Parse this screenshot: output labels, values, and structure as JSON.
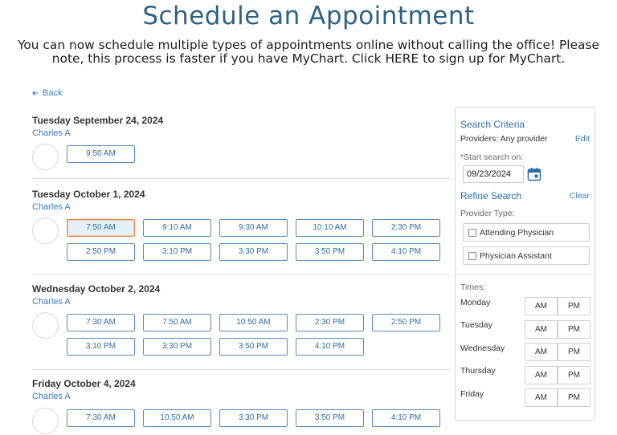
{
  "header": {
    "title": "Schedule an Appointment",
    "intro": "You can now schedule multiple types of appointments online without calling the office! Please note, this process is faster if you have MyChart. Click HERE to sign up for MyChart."
  },
  "back": {
    "label": "Back",
    "icon": "arrow-left-icon"
  },
  "dates": [
    {
      "heading": "Tuesday September 24, 2024",
      "provider": "Charles A",
      "times": [
        "9:50 AM"
      ]
    },
    {
      "heading": "Tuesday October 1, 2024",
      "provider": "Charles A",
      "times": [
        "7:50 AM",
        "9:10 AM",
        "9:30 AM",
        "10:10 AM",
        "2:30 PM",
        "2:50 PM",
        "3:10 PM",
        "3:30 PM",
        "3:50 PM",
        "4:10 PM"
      ]
    },
    {
      "heading": "Wednesday October 2, 2024",
      "provider": "Charles A",
      "times": [
        "7:30 AM",
        "7:50 AM",
        "10:50 AM",
        "2:30 PM",
        "2:50 PM",
        "3:10 PM",
        "3:30 PM",
        "3:50 PM",
        "4:10 PM"
      ]
    },
    {
      "heading": "Friday October 4, 2024",
      "provider": "Charles A",
      "times": [
        "7:30 AM",
        "10:50 AM",
        "3:30 PM",
        "3:50 PM",
        "4:10 PM"
      ]
    }
  ],
  "sidebar": {
    "search_criteria": "Search Criteria",
    "providers_label": "Providers:",
    "providers_value": "Any provider",
    "edit": "Edit",
    "required_mark": "*",
    "start_search_label": "Start search on:",
    "start_date": "09/23/2024",
    "calendar_icon": "calendar-icon",
    "refine_search": "Refine Search",
    "clear": "Clear",
    "provider_type_label": "Provider Type:",
    "provider_types": [
      "Attending Physician",
      "Physician Assistant"
    ],
    "times_label": "Times:",
    "days": [
      "Monday",
      "Tuesday",
      "Wednesday",
      "Thursday",
      "Friday"
    ],
    "am": "AM",
    "pm": "PM"
  },
  "colors": {
    "title": "#2e6182",
    "link": "#3a7dbd",
    "slot_border": "#5a8bbd",
    "selected_border": "#e1864a"
  }
}
